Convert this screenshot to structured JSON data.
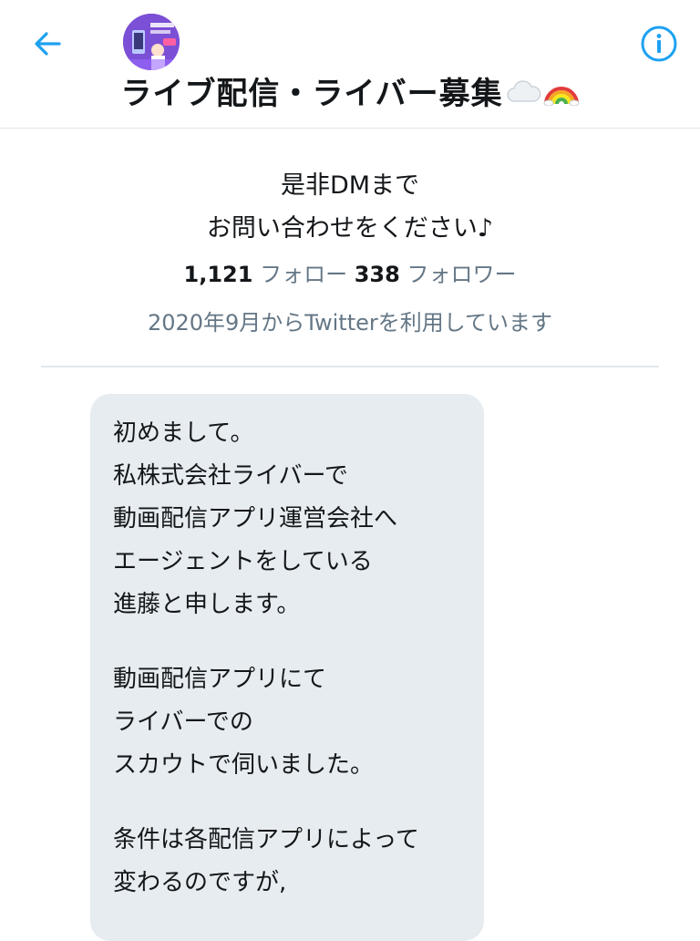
{
  "header": {
    "back_icon": "arrow-left-icon",
    "info_icon": "info-circle-icon",
    "title": "ライブ配信・ライバー募集",
    "title_emojis": [
      "cloud-emoji",
      "rainbow-emoji"
    ],
    "accent_color": "#1da1f2"
  },
  "profile": {
    "bio_lines": [
      "是非DMまで",
      "お問い合わせをください♪"
    ],
    "following_count": "1,121",
    "following_label": "フォロー",
    "followers_count": "338",
    "followers_label": "フォロワー",
    "joined": "2020年9月からTwitterを利用しています"
  },
  "message": {
    "paragraphs": [
      [
        "初めまして。",
        "私株式会社ライバーで",
        "動画配信アプリ運営会社へ",
        "エージェントをしている",
        "進藤と申します。"
      ],
      [
        "動画配信アプリにて",
        "ライバーでの",
        "スカウトで伺いました。"
      ],
      [
        "条件は各配信アプリによって",
        "変わるのですが,"
      ]
    ]
  }
}
